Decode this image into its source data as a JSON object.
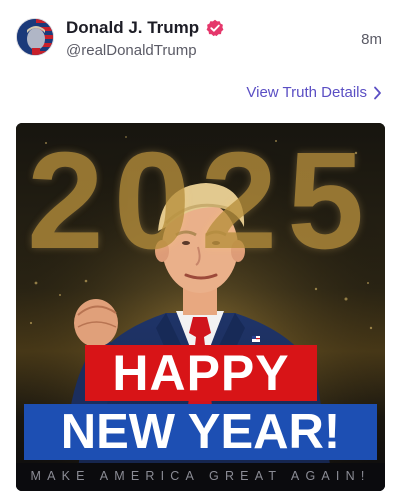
{
  "post": {
    "display_name": "Donald J. Trump",
    "handle": "@realDonaldTrump",
    "timestamp": "8m",
    "view_details_label": "View Truth Details",
    "verified": true
  },
  "image": {
    "year": "2025",
    "line1": "HAPPY",
    "line2": "NEW YEAR!",
    "tagline": "MAKE AMERICA GREAT AGAIN!"
  },
  "colors": {
    "accent": "#5b4fc4",
    "verified_badge": "#e5376b",
    "banner_red": "#d81417",
    "banner_blue": "#1d4fb3",
    "year_gold": "#b8903d"
  },
  "icons": {
    "verified": "verified-badge-icon",
    "chevron": "chevron-right-icon"
  }
}
